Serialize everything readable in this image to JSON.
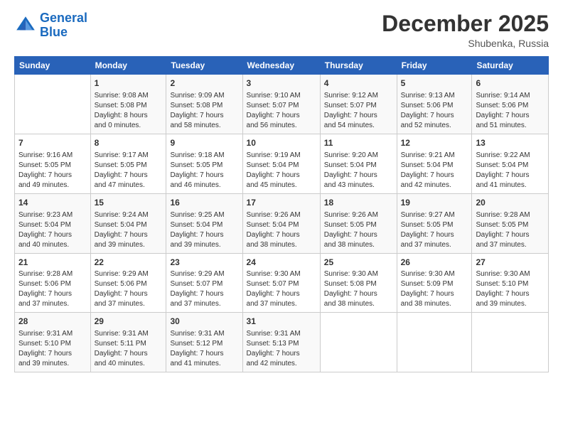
{
  "logo": {
    "line1": "General",
    "line2": "Blue"
  },
  "title": "December 2025",
  "subtitle": "Shubenka, Russia",
  "headers": [
    "Sunday",
    "Monday",
    "Tuesday",
    "Wednesday",
    "Thursday",
    "Friday",
    "Saturday"
  ],
  "weeks": [
    [
      {
        "day": "",
        "text": ""
      },
      {
        "day": "1",
        "text": "Sunrise: 9:08 AM\nSunset: 5:08 PM\nDaylight: 8 hours\nand 0 minutes."
      },
      {
        "day": "2",
        "text": "Sunrise: 9:09 AM\nSunset: 5:08 PM\nDaylight: 7 hours\nand 58 minutes."
      },
      {
        "day": "3",
        "text": "Sunrise: 9:10 AM\nSunset: 5:07 PM\nDaylight: 7 hours\nand 56 minutes."
      },
      {
        "day": "4",
        "text": "Sunrise: 9:12 AM\nSunset: 5:07 PM\nDaylight: 7 hours\nand 54 minutes."
      },
      {
        "day": "5",
        "text": "Sunrise: 9:13 AM\nSunset: 5:06 PM\nDaylight: 7 hours\nand 52 minutes."
      },
      {
        "day": "6",
        "text": "Sunrise: 9:14 AM\nSunset: 5:06 PM\nDaylight: 7 hours\nand 51 minutes."
      }
    ],
    [
      {
        "day": "7",
        "text": "Sunrise: 9:16 AM\nSunset: 5:05 PM\nDaylight: 7 hours\nand 49 minutes."
      },
      {
        "day": "8",
        "text": "Sunrise: 9:17 AM\nSunset: 5:05 PM\nDaylight: 7 hours\nand 47 minutes."
      },
      {
        "day": "9",
        "text": "Sunrise: 9:18 AM\nSunset: 5:05 PM\nDaylight: 7 hours\nand 46 minutes."
      },
      {
        "day": "10",
        "text": "Sunrise: 9:19 AM\nSunset: 5:04 PM\nDaylight: 7 hours\nand 45 minutes."
      },
      {
        "day": "11",
        "text": "Sunrise: 9:20 AM\nSunset: 5:04 PM\nDaylight: 7 hours\nand 43 minutes."
      },
      {
        "day": "12",
        "text": "Sunrise: 9:21 AM\nSunset: 5:04 PM\nDaylight: 7 hours\nand 42 minutes."
      },
      {
        "day": "13",
        "text": "Sunrise: 9:22 AM\nSunset: 5:04 PM\nDaylight: 7 hours\nand 41 minutes."
      }
    ],
    [
      {
        "day": "14",
        "text": "Sunrise: 9:23 AM\nSunset: 5:04 PM\nDaylight: 7 hours\nand 40 minutes."
      },
      {
        "day": "15",
        "text": "Sunrise: 9:24 AM\nSunset: 5:04 PM\nDaylight: 7 hours\nand 39 minutes."
      },
      {
        "day": "16",
        "text": "Sunrise: 9:25 AM\nSunset: 5:04 PM\nDaylight: 7 hours\nand 39 minutes."
      },
      {
        "day": "17",
        "text": "Sunrise: 9:26 AM\nSunset: 5:04 PM\nDaylight: 7 hours\nand 38 minutes."
      },
      {
        "day": "18",
        "text": "Sunrise: 9:26 AM\nSunset: 5:05 PM\nDaylight: 7 hours\nand 38 minutes."
      },
      {
        "day": "19",
        "text": "Sunrise: 9:27 AM\nSunset: 5:05 PM\nDaylight: 7 hours\nand 37 minutes."
      },
      {
        "day": "20",
        "text": "Sunrise: 9:28 AM\nSunset: 5:05 PM\nDaylight: 7 hours\nand 37 minutes."
      }
    ],
    [
      {
        "day": "21",
        "text": "Sunrise: 9:28 AM\nSunset: 5:06 PM\nDaylight: 7 hours\nand 37 minutes."
      },
      {
        "day": "22",
        "text": "Sunrise: 9:29 AM\nSunset: 5:06 PM\nDaylight: 7 hours\nand 37 minutes."
      },
      {
        "day": "23",
        "text": "Sunrise: 9:29 AM\nSunset: 5:07 PM\nDaylight: 7 hours\nand 37 minutes."
      },
      {
        "day": "24",
        "text": "Sunrise: 9:30 AM\nSunset: 5:07 PM\nDaylight: 7 hours\nand 37 minutes."
      },
      {
        "day": "25",
        "text": "Sunrise: 9:30 AM\nSunset: 5:08 PM\nDaylight: 7 hours\nand 38 minutes."
      },
      {
        "day": "26",
        "text": "Sunrise: 9:30 AM\nSunset: 5:09 PM\nDaylight: 7 hours\nand 38 minutes."
      },
      {
        "day": "27",
        "text": "Sunrise: 9:30 AM\nSunset: 5:10 PM\nDaylight: 7 hours\nand 39 minutes."
      }
    ],
    [
      {
        "day": "28",
        "text": "Sunrise: 9:31 AM\nSunset: 5:10 PM\nDaylight: 7 hours\nand 39 minutes."
      },
      {
        "day": "29",
        "text": "Sunrise: 9:31 AM\nSunset: 5:11 PM\nDaylight: 7 hours\nand 40 minutes."
      },
      {
        "day": "30",
        "text": "Sunrise: 9:31 AM\nSunset: 5:12 PM\nDaylight: 7 hours\nand 41 minutes."
      },
      {
        "day": "31",
        "text": "Sunrise: 9:31 AM\nSunset: 5:13 PM\nDaylight: 7 hours\nand 42 minutes."
      },
      {
        "day": "",
        "text": ""
      },
      {
        "day": "",
        "text": ""
      },
      {
        "day": "",
        "text": ""
      }
    ]
  ]
}
